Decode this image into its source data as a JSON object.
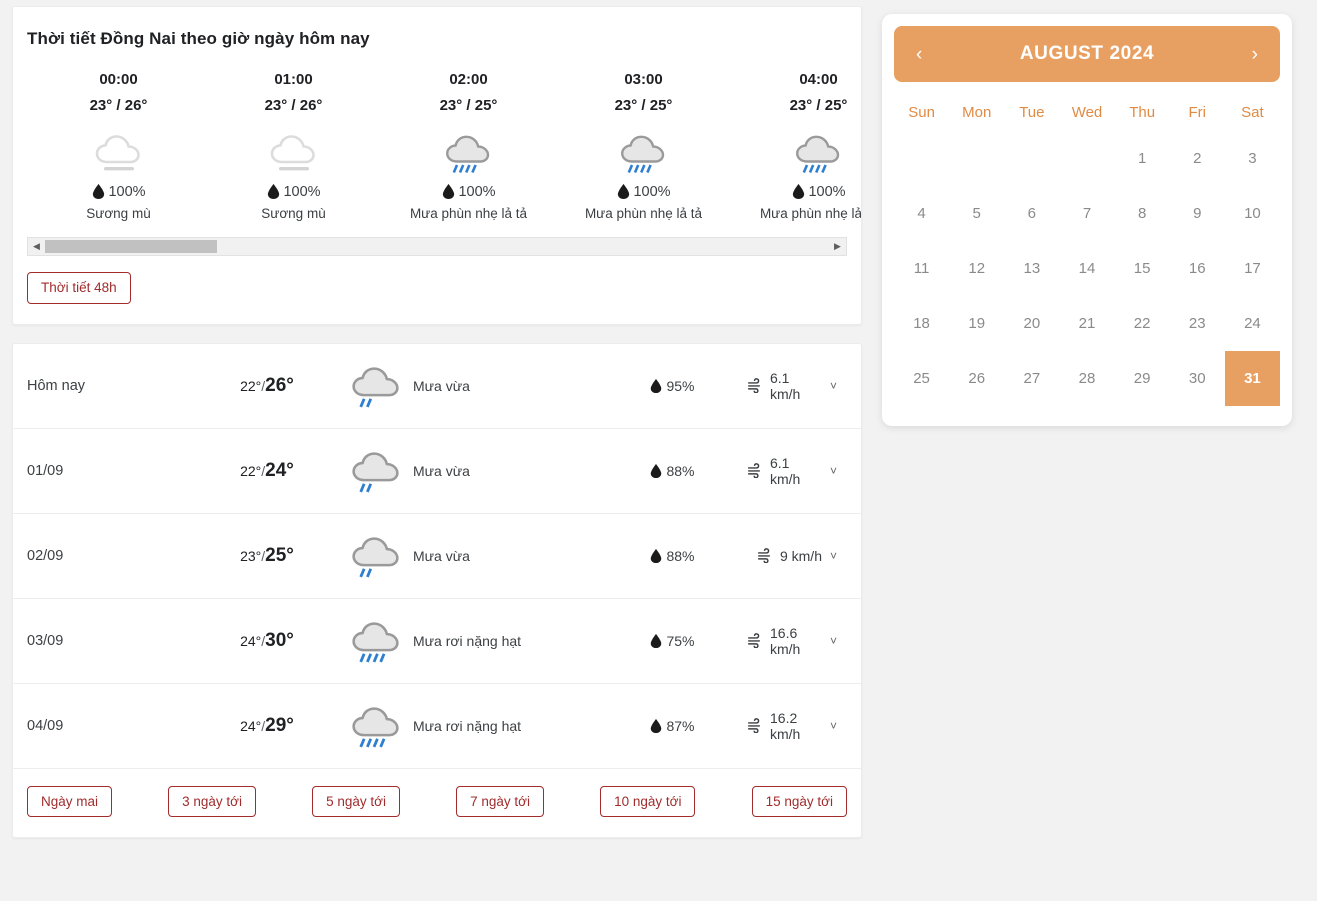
{
  "hourly": {
    "title": "Thời tiết Đồng Nai theo giờ ngày hôm nay",
    "items": [
      {
        "time": "00:00",
        "temp": "23° / 26°",
        "icon": "fog-icon",
        "pop": "100%",
        "desc": "Sương mù"
      },
      {
        "time": "01:00",
        "temp": "23° / 26°",
        "icon": "fog-icon",
        "pop": "100%",
        "desc": "Sương mù"
      },
      {
        "time": "02:00",
        "temp": "23° / 25°",
        "icon": "drizzle-icon",
        "pop": "100%",
        "desc": "Mưa phùn nhẹ lả tả"
      },
      {
        "time": "03:00",
        "temp": "23° / 25°",
        "icon": "drizzle-icon",
        "pop": "100%",
        "desc": "Mưa phùn nhẹ lả tả"
      },
      {
        "time": "04:00",
        "temp": "23° / 25°",
        "icon": "drizzle-icon",
        "pop": "100%",
        "desc": "Mưa phùn nhẹ lả tả"
      }
    ],
    "scroll_left_icon": "caret-left-icon",
    "scroll_right_icon": "caret-right-icon",
    "button_48h": "Thời tiết 48h"
  },
  "daily": {
    "rows": [
      {
        "date": "Hôm nay",
        "temp_min": "22°",
        "sep": "/",
        "temp_max": "26°",
        "icon": "rain-moderate-icon",
        "condition": "Mưa vừa",
        "humidity": "95%",
        "wind": "6.1 km/h"
      },
      {
        "date": "01/09",
        "temp_min": "22°",
        "sep": "/",
        "temp_max": "24°",
        "icon": "rain-moderate-icon",
        "condition": "Mưa vừa",
        "humidity": "88%",
        "wind": "6.1 km/h"
      },
      {
        "date": "02/09",
        "temp_min": "23°",
        "sep": "/",
        "temp_max": "25°",
        "icon": "rain-moderate-icon",
        "condition": "Mưa vừa",
        "humidity": "88%",
        "wind": "9 km/h"
      },
      {
        "date": "03/09",
        "temp_min": "24°",
        "sep": "/",
        "temp_max": "30°",
        "icon": "rain-heavy-icon",
        "condition": "Mưa rơi nặng hạt",
        "humidity": "75%",
        "wind": "16.6 km/h"
      },
      {
        "date": "04/09",
        "temp_min": "24°",
        "sep": "/",
        "temp_max": "29°",
        "icon": "rain-heavy-icon",
        "condition": "Mưa rơi nặng hạt",
        "humidity": "87%",
        "wind": "16.2 km/h"
      }
    ],
    "range_buttons": [
      "Ngày mai",
      "3 ngày tới",
      "5 ngày tới",
      "7 ngày tới",
      "10 ngày tới",
      "15 ngày tới"
    ]
  },
  "calendar": {
    "title": "AUGUST 2024",
    "prev_icon": "chevron-left-icon",
    "next_icon": "chevron-right-icon",
    "day_names": [
      "Sun",
      "Mon",
      "Tue",
      "Wed",
      "Thu",
      "Fri",
      "Sat"
    ],
    "leading_blanks": 4,
    "days": [
      1,
      2,
      3,
      4,
      5,
      6,
      7,
      8,
      9,
      10,
      11,
      12,
      13,
      14,
      15,
      16,
      17,
      18,
      19,
      20,
      21,
      22,
      23,
      24,
      25,
      26,
      27,
      28,
      29,
      30,
      31
    ],
    "selected_day": 31
  },
  "colors": {
    "accent_orange": "#e8a062",
    "button_red": "#a12c2c",
    "rain_blue": "#2f7fd1",
    "cloud_gray": "#e3e3e3",
    "page_bg": "#f2f2f2"
  }
}
